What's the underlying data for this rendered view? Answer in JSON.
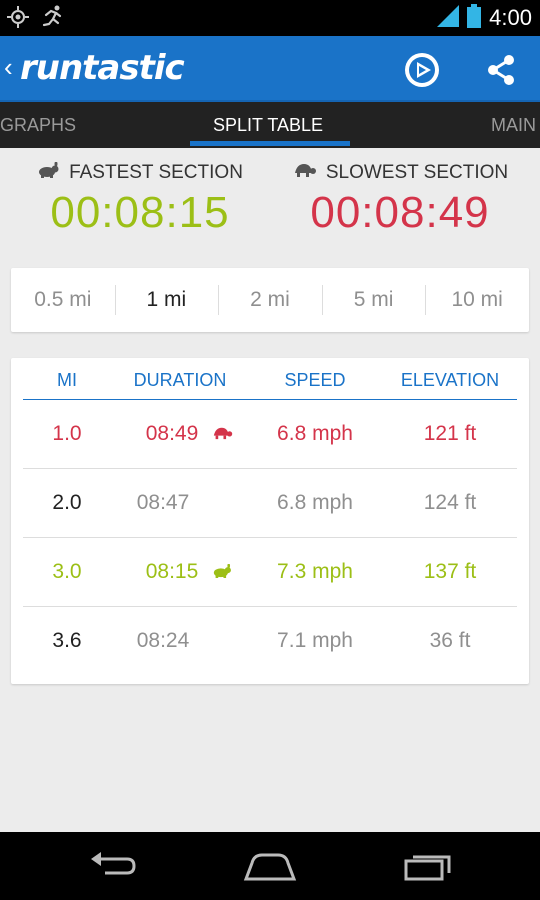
{
  "status_bar": {
    "time": "4:00",
    "icons": [
      "gps-icon",
      "runner-icon",
      "signal-icon",
      "battery-icon"
    ]
  },
  "action_bar": {
    "logo": "runtastic",
    "icons": [
      "back-chevron-icon",
      "play-logo-icon",
      "share-icon"
    ]
  },
  "tabs": [
    {
      "label": "GRAPHS"
    },
    {
      "label": "SPLIT TABLE"
    },
    {
      "label": "MAIN"
    }
  ],
  "summary": {
    "fastest": {
      "label": "FASTEST SECTION",
      "value": "00:08:15",
      "color": "#9cbf16"
    },
    "slowest": {
      "label": "SLOWEST SECTION",
      "value": "00:08:49",
      "color": "#d4344a"
    }
  },
  "distance_options": [
    {
      "label": "0.5 mi"
    },
    {
      "label": "1 mi"
    },
    {
      "label": "2 mi"
    },
    {
      "label": "5 mi"
    },
    {
      "label": "10 mi"
    }
  ],
  "selected_distance": "1 mi",
  "table": {
    "headers": [
      "MI",
      "DURATION",
      "SPEED",
      "ELEVATION"
    ],
    "rows": [
      {
        "mi": "1.0",
        "duration": "08:49",
        "speed": "6.8 mph",
        "elevation": "121 ft",
        "marker": "slowest"
      },
      {
        "mi": "2.0",
        "duration": "08:47",
        "speed": "6.8 mph",
        "elevation": "124 ft",
        "marker": ""
      },
      {
        "mi": "3.0",
        "duration": "08:15",
        "speed": "7.3 mph",
        "elevation": "137 ft",
        "marker": "fastest"
      },
      {
        "mi": "3.6",
        "duration": "08:24",
        "speed": "7.1 mph",
        "elevation": "36 ft",
        "marker": ""
      }
    ]
  },
  "colors": {
    "accent": "#1a73c8",
    "fastest": "#9cbf16",
    "slowest": "#d4344a",
    "normal_text": "#222222",
    "muted_text": "#8f8f8f"
  },
  "nav_bar": {
    "icons": [
      "back-icon",
      "home-icon",
      "recent-apps-icon"
    ]
  }
}
